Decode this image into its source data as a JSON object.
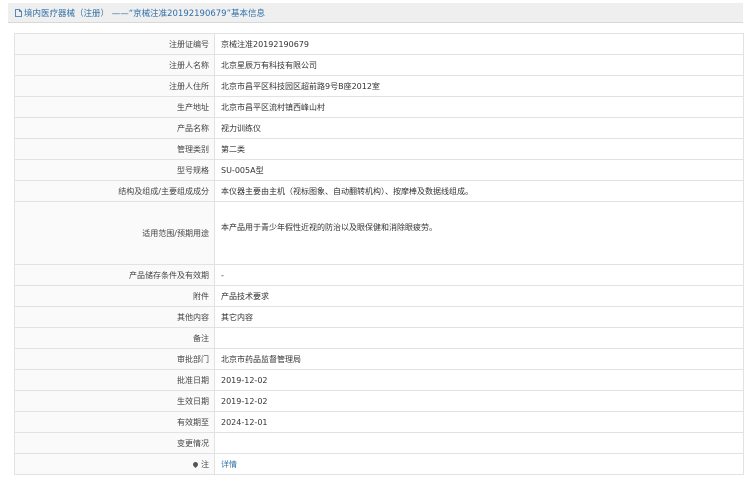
{
  "header": {
    "title": "境内医疗器械（注册） ——“京械注准20192190679”基本信息"
  },
  "rows": [
    {
      "label": "注册证编号",
      "value": "京械注准20192190679"
    },
    {
      "label": "注册人名称",
      "value": "北京星辰万有科技有限公司"
    },
    {
      "label": "注册人住所",
      "value": "北京市昌平区科技园区超前路9号B座2012室"
    },
    {
      "label": "生产地址",
      "value": "北京市昌平区流村镇西峰山村"
    },
    {
      "label": "产品名称",
      "value": "视力训练仪"
    },
    {
      "label": "管理类别",
      "value": "第二类"
    },
    {
      "label": "型号规格",
      "value": "SU-005A型"
    },
    {
      "label": "结构及组成/主要组成成分",
      "value": "本仪器主要由主机（视标图象、自动翻转机构）、按摩棒及数据线组成。"
    },
    {
      "label": "适用范围/预期用途",
      "value": "本产品用于青少年假性近视的防治以及眼保健和消除眼疲劳。"
    },
    {
      "label": "产品储存条件及有效期",
      "value": "-"
    },
    {
      "label": "附件",
      "value": "产品技术要求"
    },
    {
      "label": "其他内容",
      "value": "其它内容"
    },
    {
      "label": "备注",
      "value": ""
    },
    {
      "label": "审批部门",
      "value": "北京市药品监督管理局"
    },
    {
      "label": "批准日期",
      "value": "2019-12-02"
    },
    {
      "label": "生效日期",
      "value": "2019-12-02"
    },
    {
      "label": "有效期至",
      "value": "2024-12-01"
    },
    {
      "label": "变更情况",
      "value": ""
    },
    {
      "label": "注",
      "value": "详情"
    }
  ],
  "icons": {
    "title_icon": "document-icon",
    "note_icon": "map-pin-icon"
  },
  "colors": {
    "accent": "#2f6fa8",
    "header_bg": "#efefef",
    "border": "#e2e2e2"
  }
}
